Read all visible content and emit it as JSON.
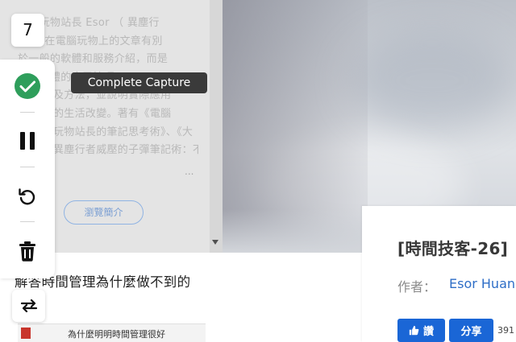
{
  "capture": {
    "count": "7",
    "tooltip": "Complete Capture",
    "buttons": [
      {
        "name": "complete",
        "icon": "check-circle-icon",
        "color": "#2e9e5b"
      },
      {
        "name": "pause",
        "icon": "pause-icon"
      },
      {
        "name": "retry",
        "icon": "rotate-left-icon"
      },
      {
        "name": "delete",
        "icon": "trash-icon"
      }
    ],
    "swap_icon": "swap-arrows-icon"
  },
  "author_panel": {
    "lines": [
      "電腦玩物站長 Esor （ 異塵行",
      "者）．在電腦玩物上的文章有別",
      "於一般的軟體和服務介紹，而是",
      "分享軟體的應用技巧",
      "及方法，並說明實際應用",
      "的生活改變。著有《電腦",
      "玩物站長的筆記思考術》、《大",
      "異塵行者威壓的子彈筆記術：不"
    ],
    "ellipsis": "...",
    "intro_button": "瀏覽簡介"
  },
  "article": {
    "title": "解答時間管理為什麼做不到的",
    "thumb_text": "為什麼明明時間管理很好"
  },
  "book": {
    "title": "[時間技客-26]",
    "author_label": "作者：",
    "author_name": "Esor Huang",
    "like_label": "讚",
    "share_label": "分享",
    "share_count": "391"
  },
  "colors": {
    "brand_blue": "#1a66d6",
    "link_blue": "#2e6ec7",
    "success_green": "#2e9e5b",
    "tooltip_bg": "#3a3a3a"
  }
}
